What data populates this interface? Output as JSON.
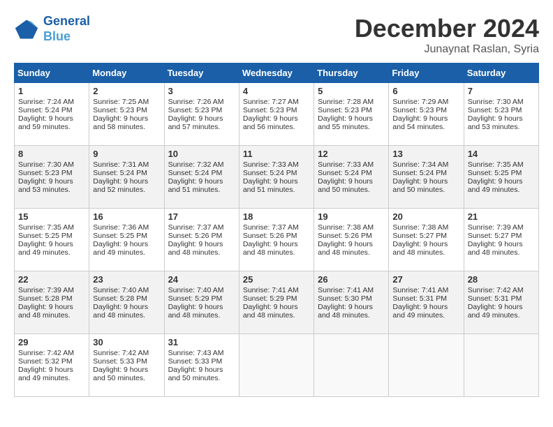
{
  "header": {
    "logo_line1": "General",
    "logo_line2": "Blue",
    "month": "December 2024",
    "location": "Junaynat Raslan, Syria"
  },
  "weekdays": [
    "Sunday",
    "Monday",
    "Tuesday",
    "Wednesday",
    "Thursday",
    "Friday",
    "Saturday"
  ],
  "weeks": [
    [
      {
        "day": "1",
        "lines": [
          "Sunrise: 7:24 AM",
          "Sunset: 5:24 PM",
          "Daylight: 9 hours",
          "and 59 minutes."
        ]
      },
      {
        "day": "2",
        "lines": [
          "Sunrise: 7:25 AM",
          "Sunset: 5:23 PM",
          "Daylight: 9 hours",
          "and 58 minutes."
        ]
      },
      {
        "day": "3",
        "lines": [
          "Sunrise: 7:26 AM",
          "Sunset: 5:23 PM",
          "Daylight: 9 hours",
          "and 57 minutes."
        ]
      },
      {
        "day": "4",
        "lines": [
          "Sunrise: 7:27 AM",
          "Sunset: 5:23 PM",
          "Daylight: 9 hours",
          "and 56 minutes."
        ]
      },
      {
        "day": "5",
        "lines": [
          "Sunrise: 7:28 AM",
          "Sunset: 5:23 PM",
          "Daylight: 9 hours",
          "and 55 minutes."
        ]
      },
      {
        "day": "6",
        "lines": [
          "Sunrise: 7:29 AM",
          "Sunset: 5:23 PM",
          "Daylight: 9 hours",
          "and 54 minutes."
        ]
      },
      {
        "day": "7",
        "lines": [
          "Sunrise: 7:30 AM",
          "Sunset: 5:23 PM",
          "Daylight: 9 hours",
          "and 53 minutes."
        ]
      }
    ],
    [
      {
        "day": "8",
        "lines": [
          "Sunrise: 7:30 AM",
          "Sunset: 5:23 PM",
          "Daylight: 9 hours",
          "and 53 minutes."
        ]
      },
      {
        "day": "9",
        "lines": [
          "Sunrise: 7:31 AM",
          "Sunset: 5:24 PM",
          "Daylight: 9 hours",
          "and 52 minutes."
        ]
      },
      {
        "day": "10",
        "lines": [
          "Sunrise: 7:32 AM",
          "Sunset: 5:24 PM",
          "Daylight: 9 hours",
          "and 51 minutes."
        ]
      },
      {
        "day": "11",
        "lines": [
          "Sunrise: 7:33 AM",
          "Sunset: 5:24 PM",
          "Daylight: 9 hours",
          "and 51 minutes."
        ]
      },
      {
        "day": "12",
        "lines": [
          "Sunrise: 7:33 AM",
          "Sunset: 5:24 PM",
          "Daylight: 9 hours",
          "and 50 minutes."
        ]
      },
      {
        "day": "13",
        "lines": [
          "Sunrise: 7:34 AM",
          "Sunset: 5:24 PM",
          "Daylight: 9 hours",
          "and 50 minutes."
        ]
      },
      {
        "day": "14",
        "lines": [
          "Sunrise: 7:35 AM",
          "Sunset: 5:25 PM",
          "Daylight: 9 hours",
          "and 49 minutes."
        ]
      }
    ],
    [
      {
        "day": "15",
        "lines": [
          "Sunrise: 7:35 AM",
          "Sunset: 5:25 PM",
          "Daylight: 9 hours",
          "and 49 minutes."
        ]
      },
      {
        "day": "16",
        "lines": [
          "Sunrise: 7:36 AM",
          "Sunset: 5:25 PM",
          "Daylight: 9 hours",
          "and 49 minutes."
        ]
      },
      {
        "day": "17",
        "lines": [
          "Sunrise: 7:37 AM",
          "Sunset: 5:26 PM",
          "Daylight: 9 hours",
          "and 48 minutes."
        ]
      },
      {
        "day": "18",
        "lines": [
          "Sunrise: 7:37 AM",
          "Sunset: 5:26 PM",
          "Daylight: 9 hours",
          "and 48 minutes."
        ]
      },
      {
        "day": "19",
        "lines": [
          "Sunrise: 7:38 AM",
          "Sunset: 5:26 PM",
          "Daylight: 9 hours",
          "and 48 minutes."
        ]
      },
      {
        "day": "20",
        "lines": [
          "Sunrise: 7:38 AM",
          "Sunset: 5:27 PM",
          "Daylight: 9 hours",
          "and 48 minutes."
        ]
      },
      {
        "day": "21",
        "lines": [
          "Sunrise: 7:39 AM",
          "Sunset: 5:27 PM",
          "Daylight: 9 hours",
          "and 48 minutes."
        ]
      }
    ],
    [
      {
        "day": "22",
        "lines": [
          "Sunrise: 7:39 AM",
          "Sunset: 5:28 PM",
          "Daylight: 9 hours",
          "and 48 minutes."
        ]
      },
      {
        "day": "23",
        "lines": [
          "Sunrise: 7:40 AM",
          "Sunset: 5:28 PM",
          "Daylight: 9 hours",
          "and 48 minutes."
        ]
      },
      {
        "day": "24",
        "lines": [
          "Sunrise: 7:40 AM",
          "Sunset: 5:29 PM",
          "Daylight: 9 hours",
          "and 48 minutes."
        ]
      },
      {
        "day": "25",
        "lines": [
          "Sunrise: 7:41 AM",
          "Sunset: 5:29 PM",
          "Daylight: 9 hours",
          "and 48 minutes."
        ]
      },
      {
        "day": "26",
        "lines": [
          "Sunrise: 7:41 AM",
          "Sunset: 5:30 PM",
          "Daylight: 9 hours",
          "and 48 minutes."
        ]
      },
      {
        "day": "27",
        "lines": [
          "Sunrise: 7:41 AM",
          "Sunset: 5:31 PM",
          "Daylight: 9 hours",
          "and 49 minutes."
        ]
      },
      {
        "day": "28",
        "lines": [
          "Sunrise: 7:42 AM",
          "Sunset: 5:31 PM",
          "Daylight: 9 hours",
          "and 49 minutes."
        ]
      }
    ],
    [
      {
        "day": "29",
        "lines": [
          "Sunrise: 7:42 AM",
          "Sunset: 5:32 PM",
          "Daylight: 9 hours",
          "and 49 minutes."
        ]
      },
      {
        "day": "30",
        "lines": [
          "Sunrise: 7:42 AM",
          "Sunset: 5:33 PM",
          "Daylight: 9 hours",
          "and 50 minutes."
        ]
      },
      {
        "day": "31",
        "lines": [
          "Sunrise: 7:43 AM",
          "Sunset: 5:33 PM",
          "Daylight: 9 hours",
          "and 50 minutes."
        ]
      },
      null,
      null,
      null,
      null
    ]
  ]
}
